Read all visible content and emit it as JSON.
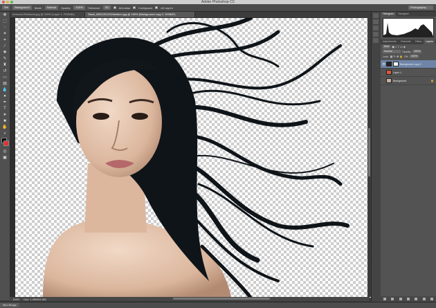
{
  "window": {
    "title": "Adobe Photoshop CC",
    "workspace": "Photography"
  },
  "options": {
    "sample": "Background",
    "mode_label": "Mode:",
    "mode": "Normal",
    "opacity_label": "Opacity:",
    "opacity": "100%",
    "tolerance_label": "Tolerance:",
    "tolerance": "32",
    "antialias": "Anti-alias",
    "contiguous": "Contiguous",
    "all_layers": "All Layers"
  },
  "tabs": [
    {
      "label": "removed-Restored.jpg @ 100% (Layer 1, RGB/8#)"
    },
    {
      "label": "Stock_B0012K11S1Medium.jpg @ 100% (Background copy 2, RGB/8*)"
    }
  ],
  "status": {
    "zoom": "100%",
    "doc": "Doc: 1.99M/11.8M"
  },
  "mini_bridge": "Mini Bridge",
  "panels": {
    "histogram_tabs": [
      "Histogram",
      "Navigator"
    ],
    "layers_tabs": [
      "Adjustments",
      "Channels",
      "Paths",
      "Layers"
    ],
    "kind": "Kind",
    "blend": "Normal",
    "opacity_label": "Opacity:",
    "opacity": "100%",
    "lock_label": "Lock:",
    "fill_label": "Fill:",
    "fill": "100%",
    "layers": [
      {
        "name": "Background copy 2",
        "selected": true,
        "visible": true
      },
      {
        "name": "Layer 1",
        "selected": false,
        "visible": false
      },
      {
        "name": "Background",
        "selected": false,
        "visible": false
      }
    ]
  },
  "colors": {
    "selection": "#6f85a8",
    "layer1_fill": "#d85a3b",
    "foreground": "#000000",
    "background": "#ffffff"
  }
}
